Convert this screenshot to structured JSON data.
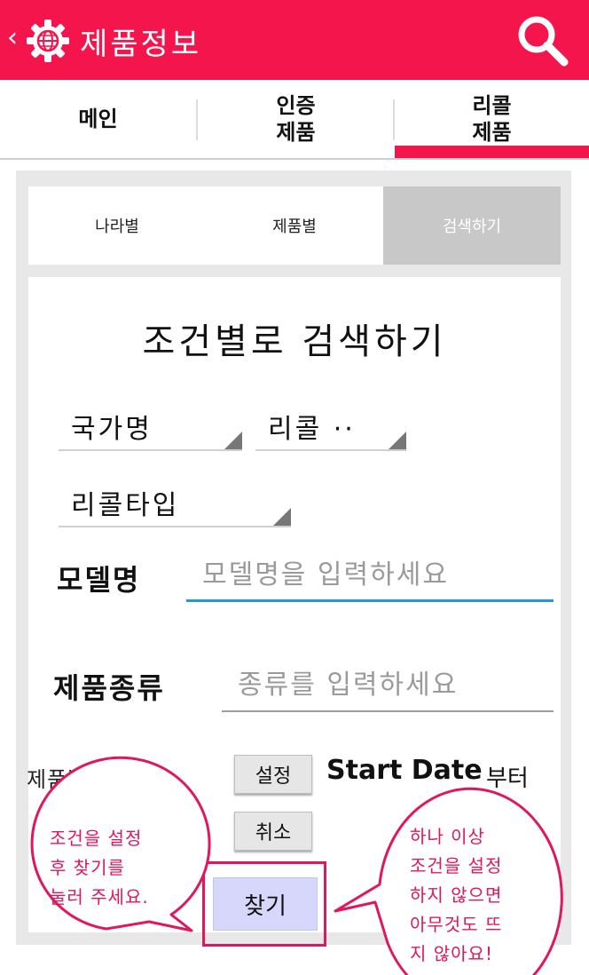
{
  "app_bar": {
    "title": "제품정보",
    "back_glyph": "‹",
    "logo_icon": "gear-globe-icon",
    "search_icon": "search-icon",
    "color": "#f5154d"
  },
  "main_tabs": [
    {
      "label": "메인"
    },
    {
      "label": "인증\n제품"
    },
    {
      "label": "리콜\n제품",
      "active": true
    }
  ],
  "sub_tabs": [
    {
      "label": "나라별"
    },
    {
      "label": "제품별"
    },
    {
      "label": "검색하기",
      "active": true
    }
  ],
  "form": {
    "title": "조건별로 검색하기",
    "spinners": [
      {
        "selected": "국가명"
      },
      {
        "selected": "리콜 ··"
      },
      {
        "selected": "리콜타입"
      }
    ],
    "model": {
      "label": "모델명",
      "value": "",
      "placeholder": "모델명을 입력하세요"
    },
    "product_type": {
      "label": "제품종류",
      "value": "",
      "placeholder": "종류를 입력하세요"
    },
    "issue_date": {
      "label": "제품발행일자",
      "set_button": "설정",
      "start_date": "Start Date",
      "suffix": "부터",
      "cancel_button": "취소"
    },
    "find_button": "찾기"
  },
  "annotations": {
    "left_bubble": "조건을 설정\n후 찾기를\n눌러 주세요.",
    "right_bubble": "하나 이상\n조건을 설정\n하지 않으면\n아무것도 뜨\n지 않아요!",
    "color": "#e0175a"
  }
}
